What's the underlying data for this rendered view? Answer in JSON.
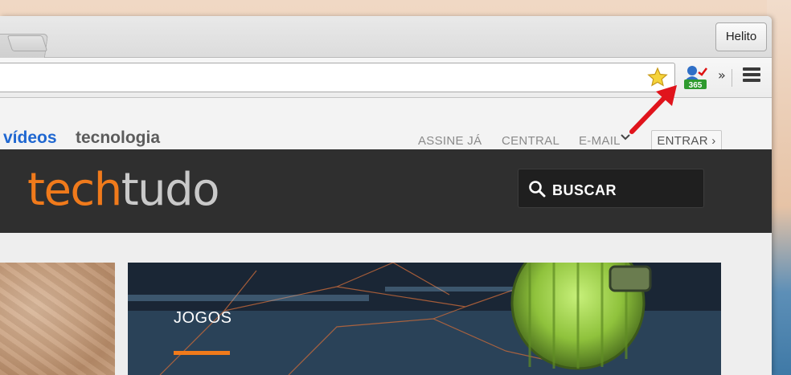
{
  "browser": {
    "profile_name": "Helito",
    "extension_badge": "365",
    "overflow_chevron": "»"
  },
  "site_nav": {
    "left_links": [
      "vídeos",
      "tecnologia"
    ],
    "right_links": [
      "ASSINE JÁ",
      "CENTRAL",
      "E-MAIL"
    ],
    "login_button": "ENTRAR ›"
  },
  "header": {
    "logo_part1": "tech",
    "logo_part2": "tudo",
    "search_label": "BUSCAR"
  },
  "feature": {
    "category": "JOGOS"
  },
  "colors": {
    "brand_orange": "#f07a1b",
    "link_blue": "#1f67d1",
    "header_dark": "#2f2f2f",
    "annotation_red": "#e0141c"
  }
}
